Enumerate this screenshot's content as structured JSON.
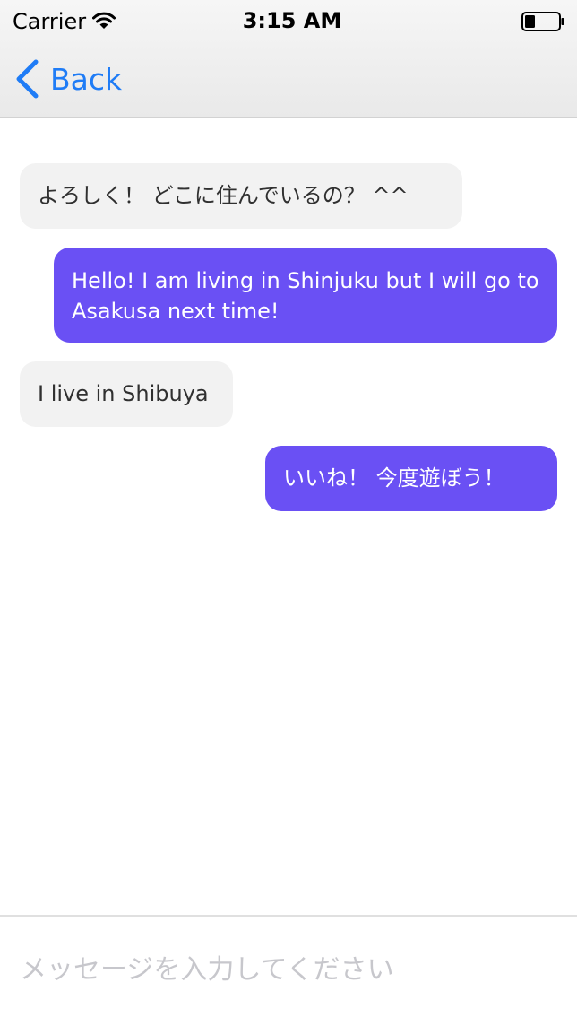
{
  "status_bar": {
    "carrier": "Carrier",
    "time": "3:15 AM",
    "icons": [
      "wifi-icon",
      "battery-icon"
    ]
  },
  "nav": {
    "back_label": "Back",
    "icon": "chevron-left-icon",
    "accent_color": "#1f7cf6"
  },
  "messages": [
    {
      "direction": "incoming",
      "text": "よろしく！ どこに住んでいるの？ ^^"
    },
    {
      "direction": "outgoing",
      "text": "Hello! I am living in Shinjuku but I will go to Asakusa next time!"
    },
    {
      "direction": "incoming",
      "text": "I live in Shibuya"
    },
    {
      "direction": "outgoing",
      "text": "いいね！ 今度遊ぼう！"
    }
  ],
  "colors": {
    "incoming_bubble": "#f2f2f2",
    "outgoing_bubble": "#6a50f4",
    "outgoing_text": "#ffffff"
  },
  "composer": {
    "placeholder": "メッセージを入力してください",
    "value": ""
  }
}
